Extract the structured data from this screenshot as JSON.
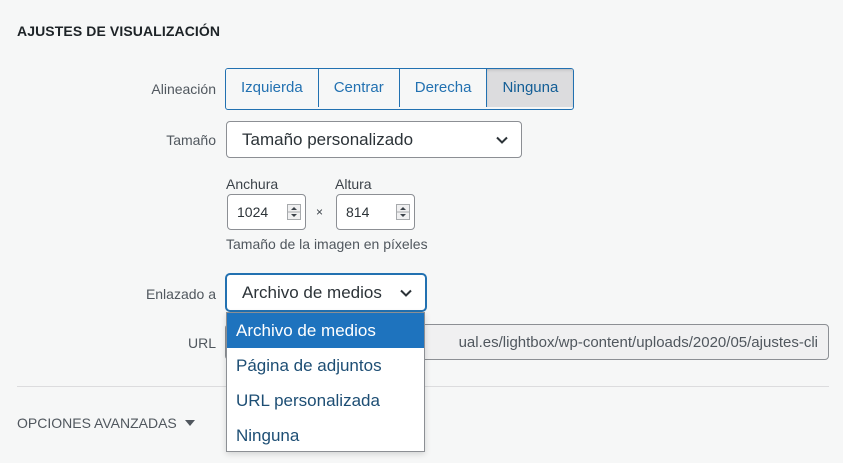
{
  "section": {
    "title": "AJUSTES DE VISUALIZACIÓN"
  },
  "alignment": {
    "label": "Alineación",
    "options": [
      "Izquierda",
      "Centrar",
      "Derecha",
      "Ninguna"
    ],
    "selected": "Ninguna"
  },
  "size": {
    "label": "Tamaño",
    "selected": "Tamaño personalizado",
    "width_label": "Anchura",
    "width_value": "1024",
    "height_label": "Altura",
    "height_value": "814",
    "separator": "×",
    "hint": "Tamaño de la imagen en píxeles"
  },
  "link": {
    "label": "Enlazado a",
    "selected": "Archivo de medios",
    "options": [
      "Archivo de medios",
      "Página de adjuntos",
      "URL personalizada",
      "Ninguna"
    ],
    "highlighted": "Archivo de medios"
  },
  "url": {
    "label": "URL",
    "value": "ual.es/lightbox/wp-content/uploads/2020/05/ajustes-cli"
  },
  "advanced": {
    "label": "OPCIONES AVANZADAS",
    "icon": "triangle-down-icon"
  },
  "colors": {
    "accent": "#2271b1",
    "highlight": "#1e73be"
  }
}
